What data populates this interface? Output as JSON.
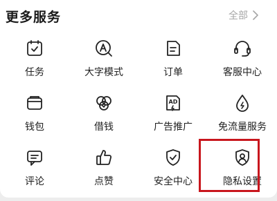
{
  "section": {
    "title": "更多服务",
    "all_label": "全部"
  },
  "items": [
    {
      "label": "任务",
      "icon": "task-calendar-icon"
    },
    {
      "label": "大字模式",
      "icon": "large-font-icon"
    },
    {
      "label": "订单",
      "icon": "order-document-icon"
    },
    {
      "label": "客服中心",
      "icon": "headset-icon"
    },
    {
      "label": "钱包",
      "icon": "wallet-icon"
    },
    {
      "label": "借钱",
      "icon": "borrow-money-icon"
    },
    {
      "label": "广告推广",
      "icon": "ad-promotion-icon"
    },
    {
      "label": "免流量服务",
      "icon": "data-drop-icon"
    },
    {
      "label": "评论",
      "icon": "comment-icon"
    },
    {
      "label": "点赞",
      "icon": "thumbs-up-icon"
    },
    {
      "label": "安全中心",
      "icon": "shield-check-icon"
    },
    {
      "label": "隐私设置",
      "icon": "privacy-shield-icon"
    }
  ],
  "highlight": {
    "target": "隐私设置",
    "color": "#c8161d"
  },
  "colors": {
    "text": "#1f1f1f",
    "muted": "#a6a6a6",
    "background": "#ffffff"
  }
}
